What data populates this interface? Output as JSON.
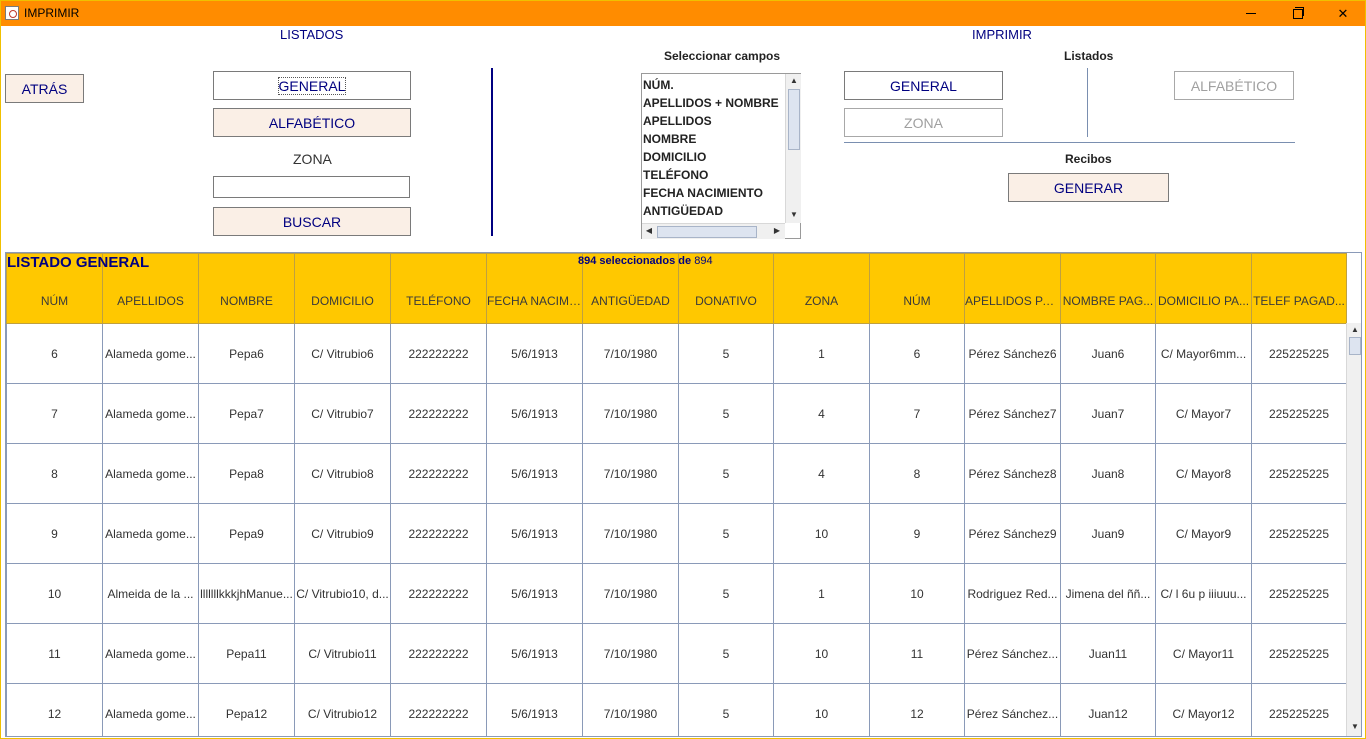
{
  "window": {
    "title": "IMPRIMIR",
    "close_label": "✕"
  },
  "left_panel": {
    "section_label": "LISTADOS",
    "back_button": "ATRÁS",
    "general_button": "GENERAL",
    "alphabetic_button": "ALFABÉTICO",
    "zone_label": "ZONA",
    "zone_value": "",
    "search_button": "BUSCAR"
  },
  "right_panel": {
    "section_label": "IMPRIMIR",
    "select_fields_label": "Seleccionar campos",
    "fields": [
      "NÚM.",
      "APELLIDOS + NOMBRE",
      "APELLIDOS",
      "NOMBRE",
      "DOMICILIO",
      "TELÉFONO",
      "FECHA NACIMIENTO",
      "ANTIGÜEDAD"
    ],
    "listados_label": "Listados",
    "general_button": "GENERAL",
    "zone_button": "ZONA",
    "alphabetic_button": "ALFABÉTICO",
    "receipts_label": "Recibos",
    "generate_button": "GENERAR"
  },
  "table": {
    "title": "LISTADO GENERAL",
    "selected_count": "894",
    "selected_text": "seleccionados de",
    "total_count": "894",
    "columns": [
      "NÚM",
      "APELLIDOS",
      "NOMBRE",
      "DOMICILIO",
      "TELÉFONO",
      "FECHA NACIMI...",
      "ANTIGÜEDAD",
      "DONATIVO",
      "ZONA",
      "NÚM",
      "APELLIDOS PA...",
      "NOMBRE PAG...",
      "DOMICILIO PA...",
      "TELEF PAGAD..."
    ],
    "rows": [
      [
        "6",
        "Alameda gome...",
        "Pepa6",
        "C/ Vitrubio6",
        "222222222",
        "5/6/1913",
        "7/10/1980",
        "5",
        "1",
        "6",
        "Pérez Sánchez6",
        "Juan6",
        "C/ Mayor6mm...",
        "225225225"
      ],
      [
        "7",
        "Alameda gome...",
        "Pepa7",
        "C/ Vitrubio7",
        "222222222",
        "5/6/1913",
        "7/10/1980",
        "5",
        "4",
        "7",
        "Pérez Sánchez7",
        "Juan7",
        "C/ Mayor7",
        "225225225"
      ],
      [
        "8",
        "Alameda gome...",
        "Pepa8",
        "C/ Vitrubio8",
        "222222222",
        "5/6/1913",
        "7/10/1980",
        "5",
        "4",
        "8",
        "Pérez Sánchez8",
        "Juan8",
        "C/ Mayor8",
        "225225225"
      ],
      [
        "9",
        "Alameda gome...",
        "Pepa9",
        "C/ Vitrubio9",
        "222222222",
        "5/6/1913",
        "7/10/1980",
        "5",
        "10",
        "9",
        "Pérez Sánchez9",
        "Juan9",
        "C/ Mayor9",
        "225225225"
      ],
      [
        "10",
        "Almeida de la ...",
        "lllllllkkkjhManue...",
        "C/ Vitrubio10, d...",
        "222222222",
        "5/6/1913",
        "7/10/1980",
        "5",
        "1",
        "10",
        "Rodriguez Red...",
        "Jimena del ññ...",
        "C/ l 6u p iiiuuu...",
        "225225225"
      ],
      [
        "11",
        "Alameda gome...",
        "Pepa11",
        "C/ Vitrubio11",
        "222222222",
        "5/6/1913",
        "7/10/1980",
        "5",
        "10",
        "11",
        "Pérez Sánchez...",
        "Juan11",
        "C/ Mayor11",
        "225225225"
      ],
      [
        "12",
        "Alameda gome...",
        "Pepa12",
        "C/ Vitrubio12",
        "222222222",
        "5/6/1913",
        "7/10/1980",
        "5",
        "10",
        "12",
        "Pérez Sánchez...",
        "Juan12",
        "C/ Mayor12",
        "225225225"
      ]
    ]
  },
  "colors": {
    "titlebar": "#ff8c00",
    "header_bg": "#ffc800",
    "accent": "#000080",
    "button_bg": "#faefe6"
  }
}
